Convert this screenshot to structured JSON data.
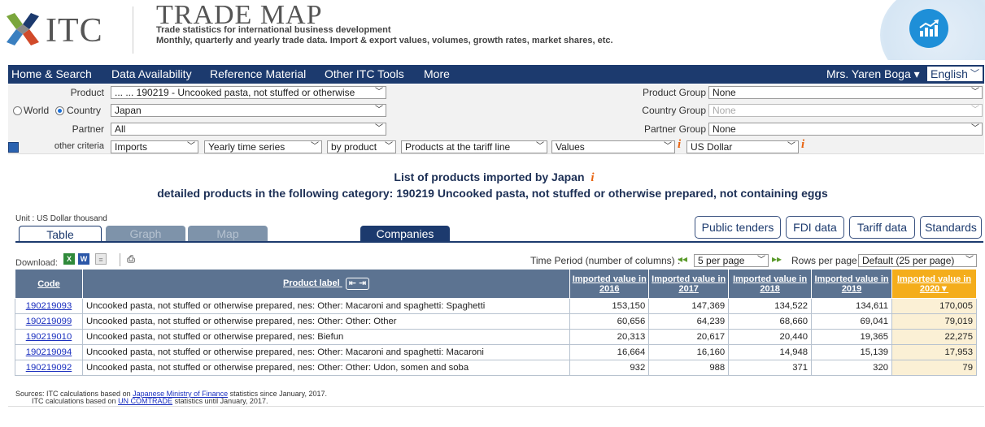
{
  "header": {
    "itc": "ITC",
    "title": "TRADE MAP",
    "subtitle1": "Trade statistics for international business development",
    "subtitle2": "Monthly, quarterly and yearly trade data. Import & export values, volumes, growth rates, market shares, etc."
  },
  "nav": {
    "items": [
      "Home & Search",
      "Data Availability",
      "Reference Material",
      "Other ITC Tools",
      "More"
    ],
    "user": "Mrs. Yaren Boga ▾",
    "language": "English"
  },
  "criteria": {
    "product_label": "Product",
    "product_value": "... ... 190219 - Uncooked pasta, not stuffed or otherwise",
    "world_label": "World",
    "country_label": "Country",
    "country_value": "Japan",
    "partner_label": "Partner",
    "partner_value": "All",
    "other_label": "other criteria",
    "flow": "Imports",
    "series": "Yearly time series",
    "by": "by product",
    "level": "Products at the tariff line",
    "measure": "Values",
    "currency": "US Dollar",
    "product_group_label": "Product Group",
    "product_group_value": "None",
    "country_group_label": "Country Group",
    "country_group_value": "None",
    "partner_group_label": "Partner Group",
    "partner_group_value": "None"
  },
  "page": {
    "title": "List of products imported by Japan",
    "subtitle": "detailed products in the following category: 190219 Uncooked pasta, not stuffed or otherwise prepared, not containing eggs",
    "unit": "Unit : US Dollar thousand"
  },
  "tabs": [
    "Table",
    "Graph",
    "Map",
    "Companies"
  ],
  "buttons": [
    "Public tenders",
    "FDI data",
    "Tariff data",
    "Standards"
  ],
  "toolbar": {
    "download": "Download:",
    "time_period": "Time Period (number of columns) :",
    "per_page": "5 per page",
    "rows_label": "Rows per page",
    "rows_value": "Default (25 per page)"
  },
  "table": {
    "headers": [
      "Code",
      "Product label",
      "Imported value in 2016",
      "Imported value in 2017",
      "Imported value in 2018",
      "Imported value in 2019",
      "Imported value in 2020"
    ],
    "rows": [
      {
        "code": "190219093",
        "label": "Uncooked pasta, not stuffed or otherwise prepared, nes: Other: Macaroni and spaghetti: Spaghetti",
        "v2016": "153,150",
        "v2017": "147,369",
        "v2018": "134,522",
        "v2019": "134,611",
        "v2020": "170,005"
      },
      {
        "code": "190219099",
        "label": "Uncooked pasta, not stuffed or otherwise prepared, nes: Other: Other: Other",
        "v2016": "60,656",
        "v2017": "64,239",
        "v2018": "68,660",
        "v2019": "69,041",
        "v2020": "79,019"
      },
      {
        "code": "190219010",
        "label": "Uncooked pasta, not stuffed or otherwise prepared, nes: Biefun",
        "v2016": "20,313",
        "v2017": "20,617",
        "v2018": "20,440",
        "v2019": "19,365",
        "v2020": "22,275"
      },
      {
        "code": "190219094",
        "label": "Uncooked pasta, not stuffed or otherwise prepared, nes: Other: Macaroni and spaghetti: Macaroni",
        "v2016": "16,664",
        "v2017": "16,160",
        "v2018": "14,948",
        "v2019": "15,139",
        "v2020": "17,953"
      },
      {
        "code": "190219092",
        "label": "Uncooked pasta, not stuffed or otherwise prepared, nes: Other: Other: Udon, somen and soba",
        "v2016": "932",
        "v2017": "988",
        "v2018": "371",
        "v2019": "320",
        "v2020": "79"
      }
    ]
  },
  "sources": {
    "line1_prefix": "Sources: ITC calculations based on ",
    "line1_link": "Japanese Ministry of Finance",
    "line1_suffix": " statistics since January, 2017.",
    "line2_prefix": "ITC calculations based on ",
    "line2_link": "UN COMTRADE",
    "line2_suffix": " statistics until January, 2017."
  },
  "colors": {
    "nav": "#1c3a6e",
    "table_header": "#5c7391",
    "sorted_header": "#f4ad1b",
    "info": "#e8620e"
  }
}
